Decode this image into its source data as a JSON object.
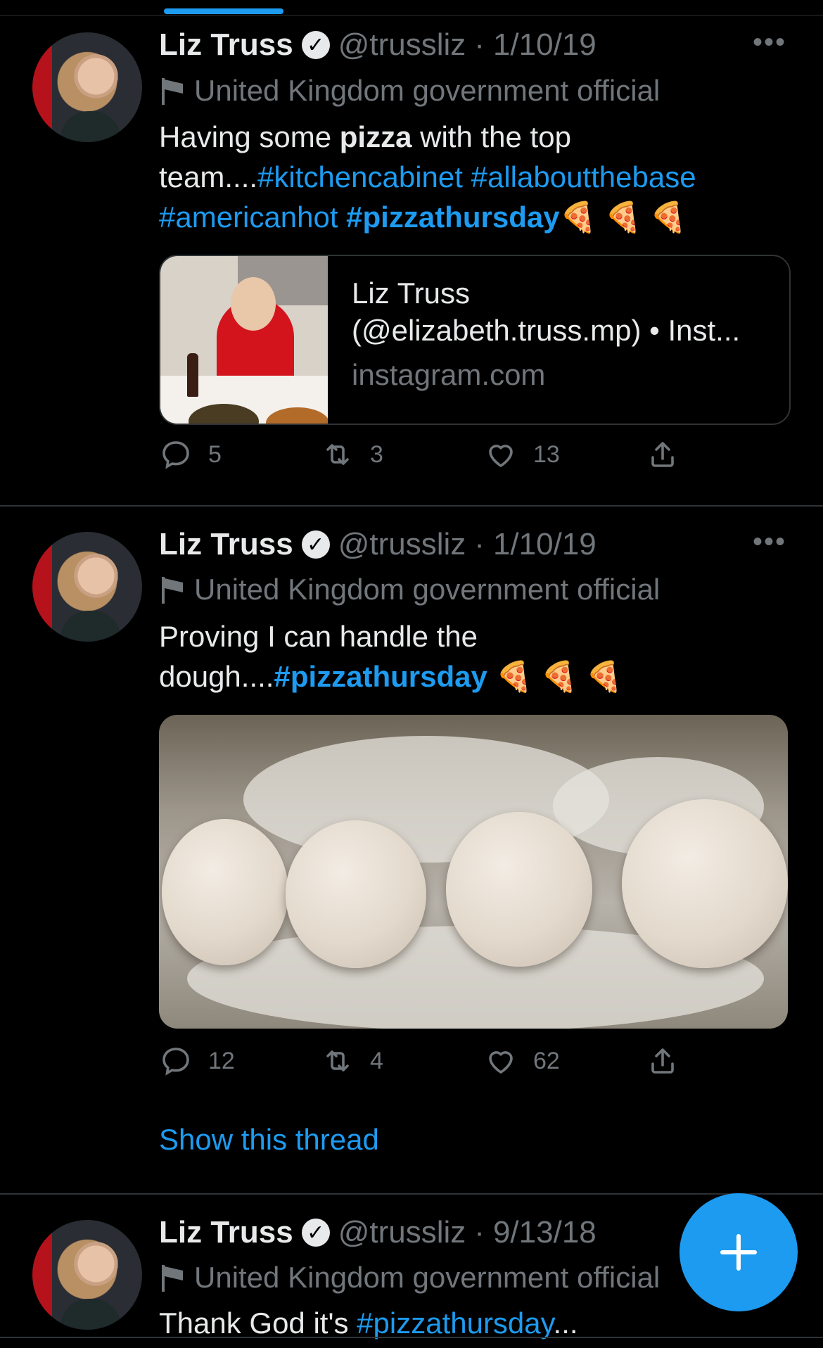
{
  "tweets": [
    {
      "name": "Liz Truss",
      "handle": "@trussliz",
      "separator": "·",
      "date": "1/10/19",
      "label": "United Kingdom government official",
      "text_parts": [
        {
          "t": "Having some ",
          "style": "plain"
        },
        {
          "t": "pizza",
          "style": "bold"
        },
        {
          "t": " with the top team....",
          "style": "plain"
        },
        {
          "t": "#kitchencabinet",
          "style": "tag"
        },
        {
          "t": " ",
          "style": "plain"
        },
        {
          "t": "#allaboutthebase",
          "style": "tag"
        },
        {
          "t": " ",
          "style": "plain"
        },
        {
          "t": "#americanhot",
          "style": "tag"
        },
        {
          "t": " ",
          "style": "plain"
        },
        {
          "t": "#pizzathursday",
          "style": "tag-bold"
        },
        {
          "t": "🍕 🍕 🍕",
          "style": "plain"
        }
      ],
      "card": {
        "title_line1": "Liz Truss",
        "title_line2": "(@elizabeth.truss.mp) • Inst...",
        "domain": "instagram.com"
      },
      "replies": "5",
      "retweets": "3",
      "likes": "13"
    },
    {
      "name": "Liz Truss",
      "handle": "@trussliz",
      "separator": "·",
      "date": "1/10/19",
      "label": "United Kingdom government official",
      "text_parts": [
        {
          "t": "Proving I can handle the dough....",
          "style": "plain"
        },
        {
          "t": "#pizzathursday",
          "style": "tag-bold"
        },
        {
          "t": " 🍕 🍕 🍕",
          "style": "plain"
        }
      ],
      "replies": "12",
      "retweets": "4",
      "likes": "62",
      "show_thread": "Show this thread"
    },
    {
      "name": "Liz Truss",
      "handle": "@trussliz",
      "separator": "·",
      "date": "9/13/18",
      "label": "United Kingdom government official",
      "text_parts": [
        {
          "t": "Thank God it's ",
          "style": "plain"
        },
        {
          "t": "#pizzathursday",
          "style": "tag"
        },
        {
          "t": "...",
          "style": "plain"
        }
      ]
    }
  ],
  "icons": {
    "verified": "verified-badge-icon",
    "more": "more-icon",
    "flag": "flag-icon",
    "reply": "reply-icon",
    "retweet": "retweet-icon",
    "like": "heart-icon",
    "share": "share-icon",
    "compose": "compose-plus-icon"
  },
  "colors": {
    "accent": "#1d9bf0",
    "background": "#000000",
    "text": "#e7e9ea",
    "secondary": "#71767b"
  }
}
